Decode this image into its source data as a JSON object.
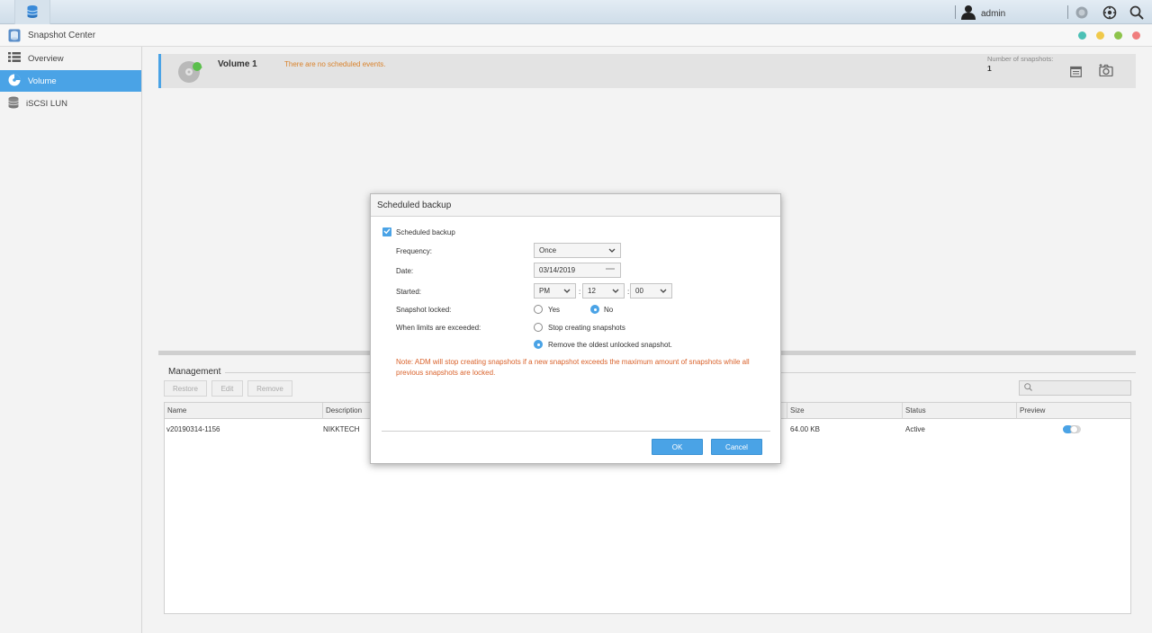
{
  "topbar": {
    "app_icon": "database-icon",
    "username": "admin",
    "icons": [
      "user-icon",
      "notification-icon",
      "settings-icon",
      "search-icon"
    ]
  },
  "window": {
    "title": "Snapshot Center",
    "controls": [
      "#4bc0b5",
      "#f0c94a",
      "#8dc34a",
      "#f07d7d"
    ]
  },
  "sidebar": {
    "items": [
      {
        "label": "Overview",
        "icon": "list-icon"
      },
      {
        "label": "Volume",
        "icon": "volume-icon",
        "active": true
      },
      {
        "label": "iSCSI LUN",
        "icon": "storage-icon"
      }
    ]
  },
  "volume": {
    "name": "Volume 1",
    "message": "There are no scheduled events.",
    "count_label": "Number of snapshots:",
    "count": "1"
  },
  "management": {
    "title": "Management",
    "buttons": {
      "restore": "Restore",
      "edit": "Edit",
      "remove": "Remove"
    },
    "search_placeholder": "",
    "columns": {
      "name": "Name",
      "description": "Description",
      "size": "Size",
      "status": "Status",
      "preview": "Preview"
    },
    "rows": [
      {
        "name": "v20190314-1156",
        "description": "NIKKTECH",
        "size": "64.00 KB",
        "status": "Active",
        "preview_on": true
      }
    ]
  },
  "dialog": {
    "title": "Scheduled backup",
    "enable_label": "Scheduled backup",
    "frequency_label": "Frequency:",
    "frequency_value": "Once",
    "date_label": "Date:",
    "date_value": "03/14/2019",
    "started_label": "Started:",
    "ampm": "PM",
    "hour": "12",
    "minute": "00",
    "time_sep": ":",
    "locked_label": "Snapshot locked:",
    "locked_yes": "Yes",
    "locked_no": "No",
    "limits_label": "When limits are exceeded:",
    "limits_stop": "Stop creating snapshots",
    "limits_remove": "Remove the oldest unlocked snapshot.",
    "note": "Note: ADM will stop creating snapshots if a new snapshot exceeds the maximum amount of snapshots while all previous snapshots are locked.",
    "ok": "OK",
    "cancel": "Cancel"
  },
  "colors": {
    "accent": "#4aa3e6",
    "warning": "#d9822b",
    "note": "#d9622b"
  }
}
